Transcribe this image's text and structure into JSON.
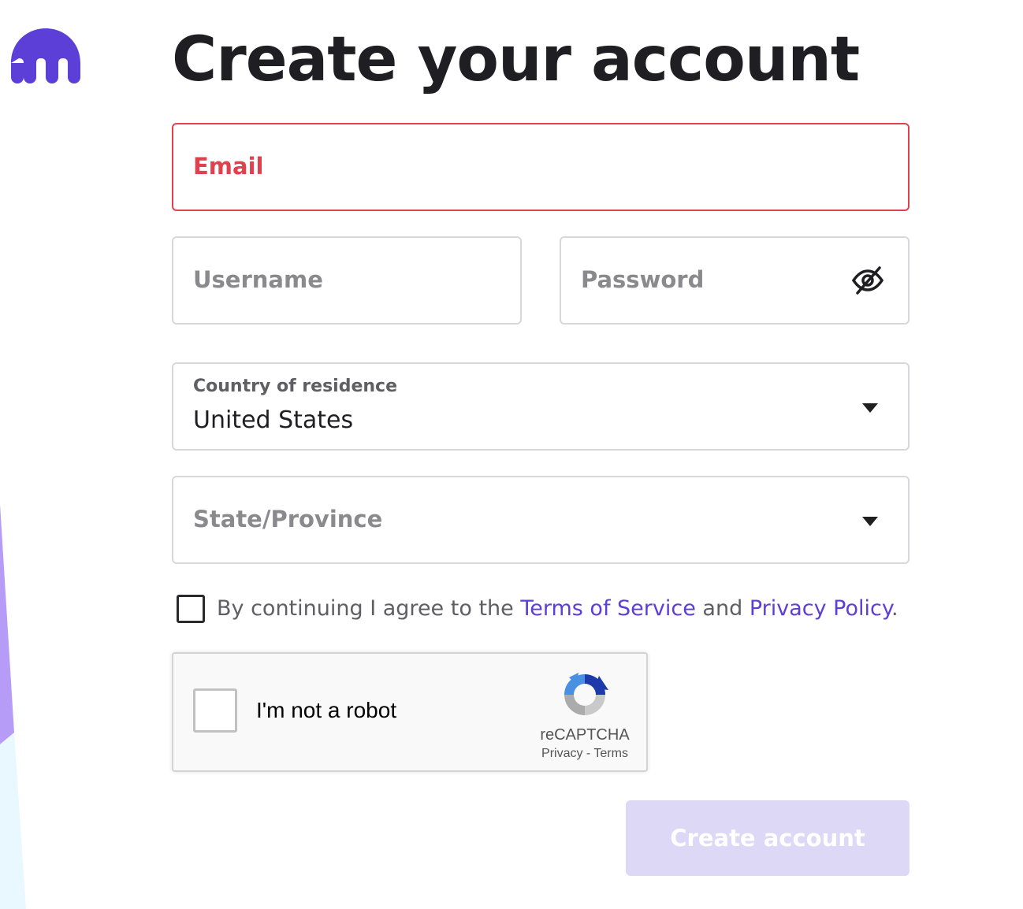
{
  "brand": {
    "logo_icon": "kraken-logo-icon",
    "accent_color": "#5b3fd6"
  },
  "page": {
    "title": "Create your account"
  },
  "form": {
    "email": {
      "placeholder": "Email",
      "state": "error",
      "error_color": "#e0414f"
    },
    "username": {
      "placeholder": "Username"
    },
    "password": {
      "placeholder": "Password",
      "toggle_icon": "eye-slash-icon"
    },
    "country": {
      "label": "Country of residence",
      "value": "United States"
    },
    "state": {
      "placeholder": "State/Province"
    },
    "agreement": {
      "checked": false,
      "prefix": "By continuing I agree to the ",
      "terms_link": "Terms of Service",
      "middle": " and ",
      "privacy_link": "Privacy Policy",
      "suffix": "."
    },
    "captcha": {
      "label": "I'm not a robot",
      "brand": "reCAPTCHA",
      "privacy": "Privacy",
      "separator": " - ",
      "terms": "Terms"
    },
    "submit": {
      "label": "Create account",
      "enabled": false
    }
  }
}
